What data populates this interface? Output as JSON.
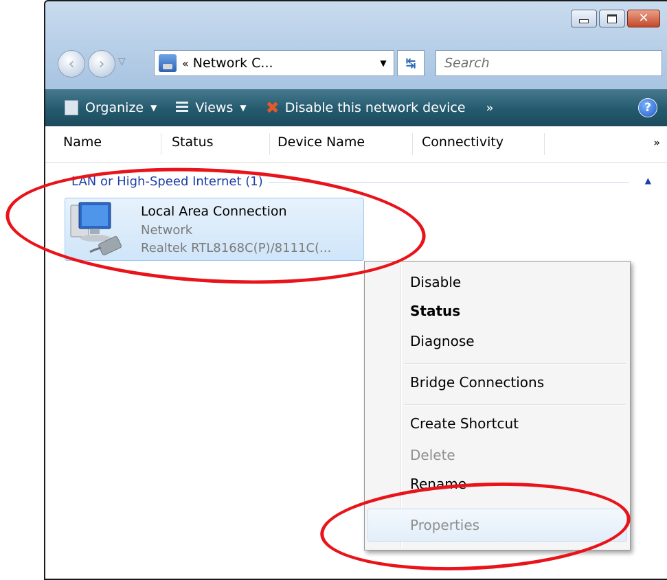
{
  "window": {
    "address": "Network C...",
    "address_chevron": "«",
    "search_placeholder": "Search"
  },
  "toolbar": {
    "organize": "Organize",
    "views": "Views",
    "disable": "Disable this network device",
    "more": "»",
    "help": "?"
  },
  "columns": [
    "Name",
    "Status",
    "Device Name",
    "Connectivity"
  ],
  "columns_more": "»",
  "group": {
    "title": "LAN or High-Speed Internet (1)"
  },
  "connection": {
    "name": "Local Area Connection",
    "status": "Network",
    "device": "Realtek RTL8168C(P)/8111C(..."
  },
  "context_menu": {
    "items": [
      "Disable",
      "Status",
      "Diagnose",
      "Bridge Connections",
      "Create Shortcut",
      "Delete",
      "Rename",
      "Properties"
    ],
    "default_item": "Status",
    "disabled_items": [
      "Delete",
      "Properties"
    ],
    "hovered_item": "Properties"
  },
  "colors": {
    "annotation": "#e8141a",
    "toolbar": "#245a6e",
    "group_title": "#1e3fa8"
  }
}
